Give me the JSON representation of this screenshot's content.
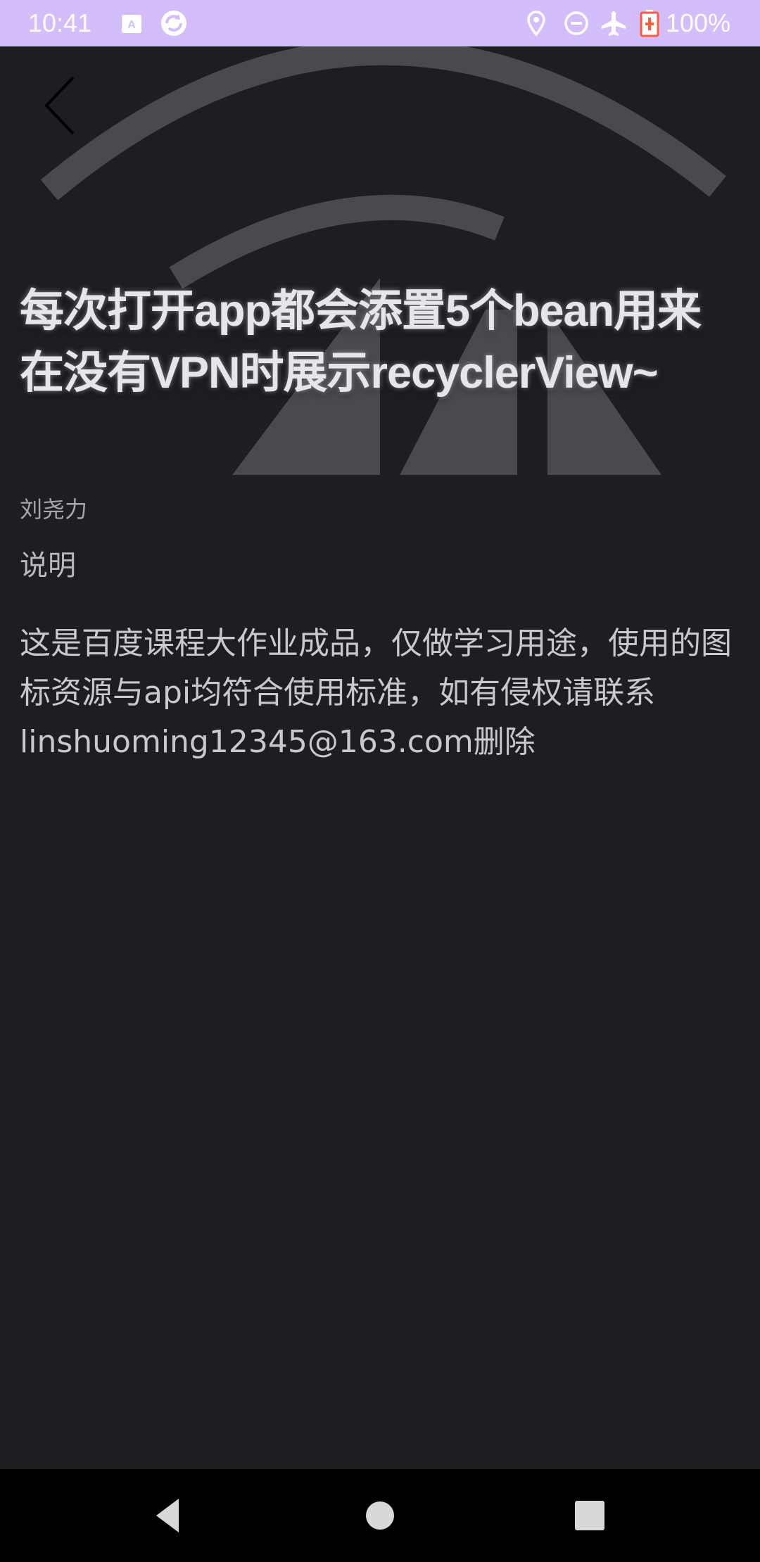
{
  "status_bar": {
    "time": "10:41",
    "battery_text": "100%",
    "background_color": "#d3bdfb",
    "icons": [
      "keyboard-a-icon",
      "sync-app-icon",
      "location-icon",
      "do-not-disturb-icon",
      "airplane-mode-icon",
      "battery-charging-icon"
    ]
  },
  "header": {
    "back_icon": "chevron-left-icon",
    "art_icon": "wifi-arc-icon"
  },
  "article": {
    "title": "每次打开app都会添置5个bean用来在没有VPN时展示recyclerView~",
    "author": "刘尧力",
    "section_label": "说明",
    "body": "这是百度课程大作业成品，仅做学习用途，使用的图标资源与api均符合使用标准，如有侵权请联系linshuoming12345@163.com删除"
  },
  "nav_bar": {
    "buttons": [
      "back-triangle-icon",
      "home-circle-icon",
      "recents-square-icon"
    ]
  },
  "colors": {
    "background": "#1e1d21",
    "art": "#4a4a4e",
    "title": "#e6e6ea",
    "body": "#c9c8cd"
  }
}
